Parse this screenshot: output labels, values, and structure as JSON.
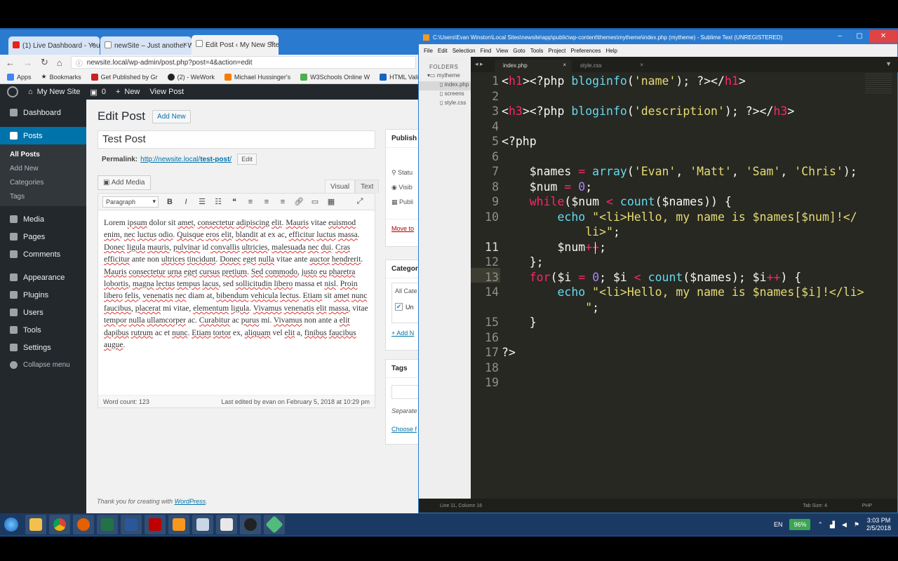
{
  "chrome": {
    "tabs": [
      {
        "label": "(1) Live Dashboard - You",
        "color": "#e62117"
      },
      {
        "label": "newSite – Just another W",
        "color": "#888888"
      },
      {
        "label": "Edit Post ‹ My New Site –",
        "color": "#888888"
      }
    ],
    "url": "newsite.local/wp-admin/post.php?post=4&action=edit",
    "bookmarks": [
      {
        "label": "Apps",
        "color": "#4285f4"
      },
      {
        "label": "Bookmarks",
        "color": "#555555"
      },
      {
        "label": "Get Published by Gr",
        "color": "#cc2222"
      },
      {
        "label": "(2) - WeWork",
        "color": "#222222"
      },
      {
        "label": "Michael Hussinger's",
        "color": "#f57d00"
      },
      {
        "label": "W3Schools Online W",
        "color": "#4caf50"
      },
      {
        "label": "HTML Validator",
        "color": "#1565c0"
      }
    ]
  },
  "wp": {
    "adminbar": {
      "site": "My New Site",
      "comments": "0",
      "new": "New",
      "view": "View Post"
    },
    "menu": {
      "dashboard": "Dashboard",
      "posts": "Posts",
      "sub": [
        "All Posts",
        "Add New",
        "Categories",
        "Tags"
      ],
      "items": [
        "Media",
        "Pages",
        "Comments",
        "Appearance",
        "Plugins",
        "Users",
        "Tools",
        "Settings",
        "Collapse menu"
      ]
    },
    "heading": "Edit Post",
    "add_new": "Add New",
    "post_title": "Test Post",
    "permalink_label": "Permalink:",
    "permalink_base": "http://newsite.local/",
    "permalink_slug": "test-post",
    "permalink_end": "/",
    "edit_btn": "Edit",
    "add_media": "Add Media",
    "tab_visual": "Visual",
    "tab_text": "Text",
    "format_select": "Paragraph",
    "toolbar_icons": [
      "bold-icon",
      "italic-icon",
      "bullet-list-icon",
      "numbered-list-icon",
      "blockquote-icon",
      "align-left-icon",
      "align-center-icon",
      "align-right-icon",
      "link-icon",
      "more-icon",
      "toolbar-toggle-icon",
      "fullscreen-icon"
    ],
    "word_count": "Word count: 123",
    "last_edited": "Last edited by evan on February 5, 2018 at 10:29 pm",
    "footer_text": "Thank you for creating with",
    "footer_link": "WordPress",
    "footer_dot": ".",
    "publish_box": {
      "title": "Publish",
      "rows": [
        "Statu",
        "Visib",
        "Publi"
      ],
      "trash": "Move to"
    },
    "categories_box": {
      "title": "Categor",
      "tab": "All Cate",
      "item": "Un",
      "add": "+ Add N"
    },
    "tags_box": {
      "title": "Tags",
      "hint": "Separate",
      "choose": "Choose f"
    }
  },
  "sublime": {
    "title": "C:\\Users\\Evan Winston\\Local Sites\\newsite\\app\\public\\wp-content\\themes\\mytheme\\index.php (mytheme) - Sublime Text (UNREGISTERED)",
    "menu": [
      "File",
      "Edit",
      "Selection",
      "Find",
      "View",
      "Goto",
      "Tools",
      "Project",
      "Preferences",
      "Help"
    ],
    "folders_header": "FOLDERS",
    "folders": [
      "mytheme",
      "index.php",
      "screens",
      "style.css"
    ],
    "tabs": [
      "index.php",
      "style.css"
    ],
    "status_left": "Line 11, Column 16",
    "status_tab": "Tab Size: 4",
    "status_syntax": "PHP"
  },
  "taskbar": {
    "lang": "EN",
    "battery": "96%",
    "time": "3:03 PM",
    "date": "2/5/2018"
  }
}
